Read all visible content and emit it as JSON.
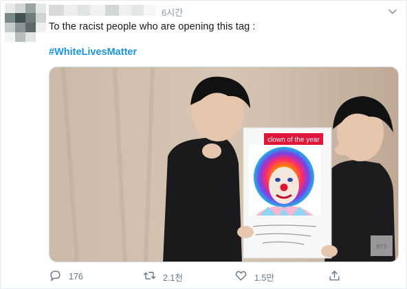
{
  "tweet": {
    "timestamp": "6시간",
    "text": "To the racist people who are opening this tag :",
    "hashtag": "#WhiteLivesMatter",
    "image": {
      "sign_label": "clown of the year",
      "watermark": "BTS"
    },
    "actions": {
      "reply_count": "176",
      "retweet_count": "2.1천",
      "like_count": "1.5만"
    }
  },
  "icons": {
    "reply": "reply-icon",
    "retweet": "retweet-icon",
    "like": "heart-icon",
    "share": "share-icon",
    "menu": "chevron-down-icon"
  },
  "colors": {
    "link": "#1b95e0",
    "muted": "#657786",
    "sign_label_bg": "#e0153a"
  }
}
